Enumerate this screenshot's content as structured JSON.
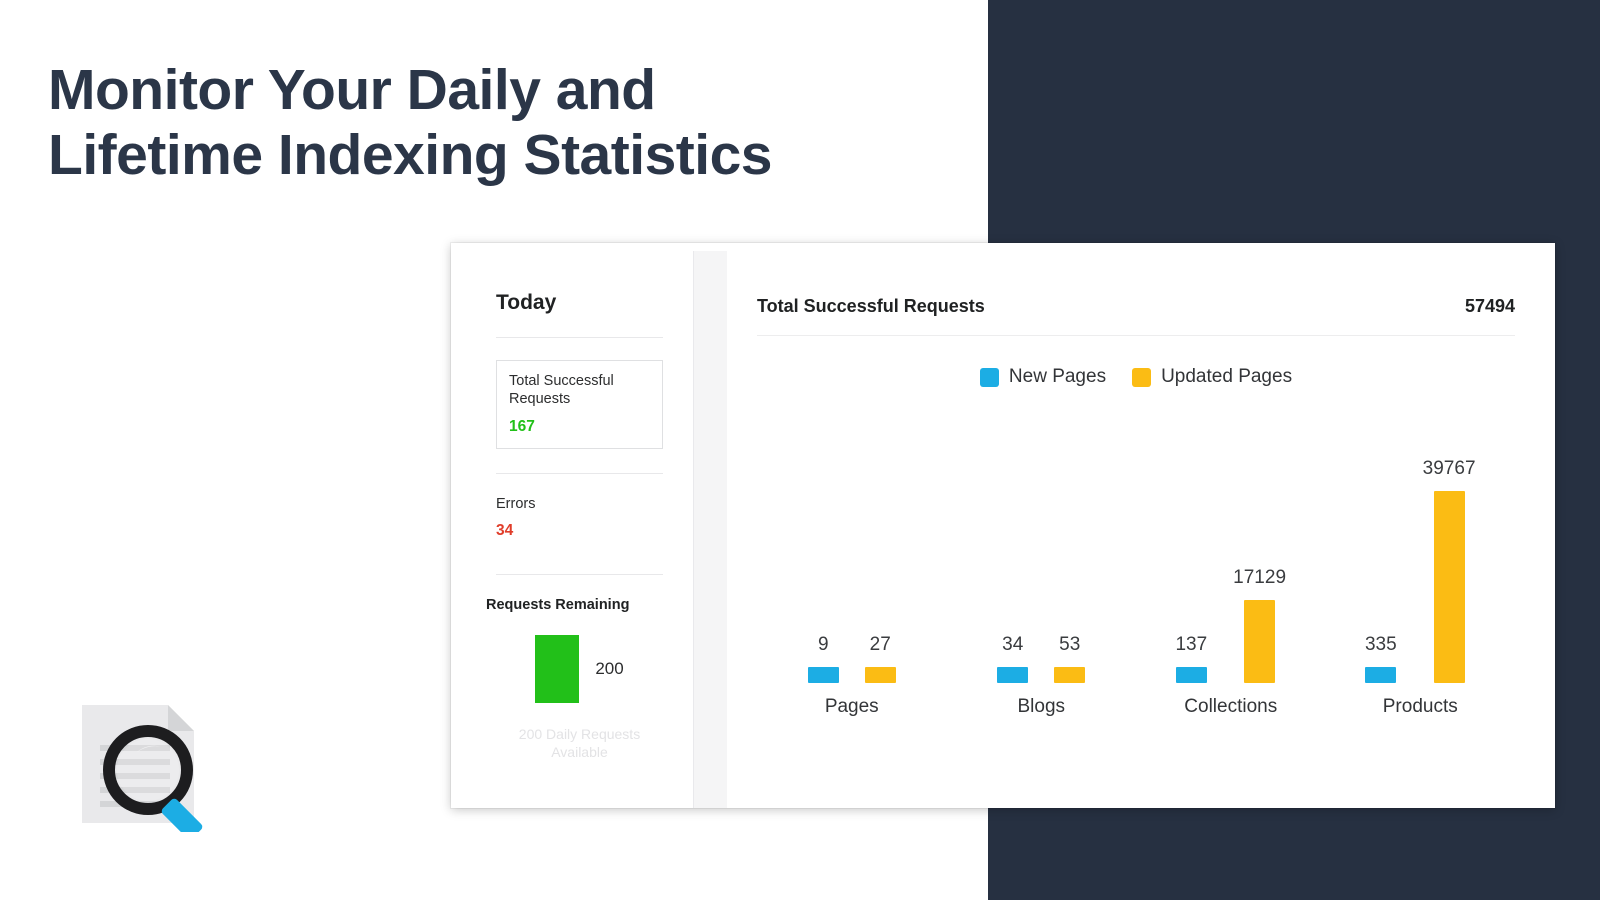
{
  "headline": {
    "line1": "Monitor Your Daily and",
    "line2": "Lifetime Indexing Statistics"
  },
  "colors": {
    "navy_background": "#263041",
    "new_pages": "#1cade4",
    "updated_pages": "#fbbc14",
    "success_green": "#22c019",
    "error_red": "#e03d2a",
    "headline_text": "#2b3648"
  },
  "sidebar": {
    "title": "Today",
    "total_successful": {
      "label": "Total Successful Requests",
      "value": "167"
    },
    "errors": {
      "label": "Errors",
      "value": "34"
    },
    "requests_remaining": {
      "label": "Requests Remaining",
      "value": "200",
      "footnote": "200 Daily Requests Available"
    }
  },
  "chart_panel": {
    "title": "Total Successful Requests",
    "total": "57494",
    "legend": [
      {
        "label": "New Pages",
        "color": "#1cade4"
      },
      {
        "label": "Updated Pages",
        "color": "#fbbc14"
      }
    ]
  },
  "chart_data": {
    "type": "bar",
    "title": "Total Successful Requests",
    "xlabel": "",
    "ylabel": "",
    "grid": false,
    "legend_position": "top-center",
    "categories": [
      "Pages",
      "Blogs",
      "Collections",
      "Products"
    ],
    "series": [
      {
        "name": "New Pages",
        "color": "#1cade4",
        "values": [
          9,
          34,
          137,
          335
        ]
      },
      {
        "name": "Updated Pages",
        "color": "#fbbc14",
        "values": [
          27,
          53,
          17129,
          39767
        ]
      }
    ],
    "total_label": "57494",
    "ylim": [
      0,
      39767
    ],
    "value_labels": {
      "Pages": [
        "9",
        "27"
      ],
      "Blogs": [
        "34",
        "53"
      ],
      "Collections": [
        "137",
        "17129"
      ],
      "Products": [
        "335",
        "39767"
      ]
    }
  },
  "icons": {
    "document_search": "document-magnifier-icon"
  }
}
